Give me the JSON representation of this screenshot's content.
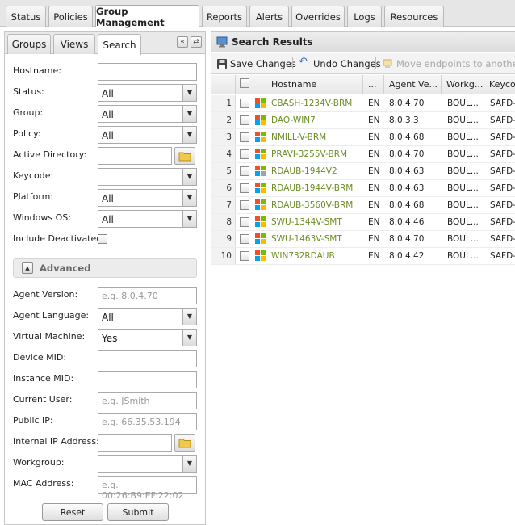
{
  "top_tabs": [
    {
      "label": "Status"
    },
    {
      "label": "Policies"
    },
    {
      "label": "Group Management",
      "active": true
    },
    {
      "label": "Reports"
    },
    {
      "label": "Alerts"
    },
    {
      "label": "Overrides"
    },
    {
      "label": "Logs"
    },
    {
      "label": "Resources"
    }
  ],
  "left_tabs": [
    {
      "label": "Groups"
    },
    {
      "label": "Views"
    },
    {
      "label": "Search",
      "active": true
    }
  ],
  "search_form": {
    "hostname_label": "Hostname:",
    "status_label": "Status:",
    "status_value": "All",
    "group_label": "Group:",
    "group_value": "All",
    "policy_label": "Policy:",
    "policy_value": "All",
    "active_directory_label": "Active Directory:",
    "keycode_label": "Keycode:",
    "keycode_value": "",
    "platform_label": "Platform:",
    "platform_value": "All",
    "windows_os_label": "Windows OS:",
    "windows_os_value": "All",
    "include_deactivated_label": "Include Deactivated:",
    "advanced_label": "Advanced",
    "agent_version_label": "Agent Version:",
    "agent_version_placeholder": "e.g. 8.0.4.70",
    "agent_language_label": "Agent Language:",
    "agent_language_value": "All",
    "virtual_machine_label": "Virtual Machine:",
    "virtual_machine_value": "Yes",
    "device_mid_label": "Device MID:",
    "instance_mid_label": "Instance MID:",
    "current_user_label": "Current User:",
    "current_user_placeholder": "e.g. JSmith",
    "public_ip_label": "Public IP:",
    "public_ip_placeholder": "e.g. 66.35.53.194",
    "internal_ip_label": "Internal IP Address:",
    "workgroup_label": "Workgroup:",
    "workgroup_value": "",
    "mac_address_label": "MAC Address:",
    "mac_address_placeholder": "e.g. 00:26:B9:EF:22:02",
    "reset_label": "Reset",
    "submit_label": "Submit"
  },
  "results": {
    "title": "Search Results",
    "toolbar": {
      "save_label": "Save Changes",
      "undo_label": "Undo Changes",
      "move_label": "Move endpoints to another gro"
    },
    "columns": {
      "hostname": "Hostname",
      "lang": "...",
      "agent_version": "Agent Ve...",
      "workgroup": "Workg...",
      "keycode": "Keyco"
    },
    "rows": [
      {
        "num": "1",
        "hostname": "CBASH-1234V-BRM",
        "lang": "EN",
        "version": "8.0.4.70",
        "workgroup": "BOUL...",
        "keycode": "SAFD-",
        "icon": "windows-icon"
      },
      {
        "num": "2",
        "hostname": "DAO-WIN7",
        "lang": "EN",
        "version": "8.0.3.3",
        "workgroup": "BOUL...",
        "keycode": "SAFD-",
        "icon": "windows-icon"
      },
      {
        "num": "3",
        "hostname": "NMILL-V-BRM",
        "lang": "EN",
        "version": "8.0.4.68",
        "workgroup": "BOUL...",
        "keycode": "SAFD-",
        "icon": "windows-icon"
      },
      {
        "num": "4",
        "hostname": "PRAVI-3255V-BRM",
        "lang": "EN",
        "version": "8.0.4.70",
        "workgroup": "BOUL...",
        "keycode": "SAFD-",
        "icon": "windows-icon"
      },
      {
        "num": "5",
        "hostname": "RDAUB-1944V2",
        "lang": "EN",
        "version": "8.0.4.63",
        "workgroup": "BOUL...",
        "keycode": "SAFD-",
        "icon": "windows-server-icon"
      },
      {
        "num": "6",
        "hostname": "RDAUB-1944V-BRM",
        "lang": "EN",
        "version": "8.0.4.63",
        "workgroup": "BOUL...",
        "keycode": "SAFD-",
        "icon": "windows-icon"
      },
      {
        "num": "7",
        "hostname": "RDAUB-3560V-BRM",
        "lang": "EN",
        "version": "8.0.4.68",
        "workgroup": "BOUL...",
        "keycode": "SAFD-",
        "icon": "windows-icon"
      },
      {
        "num": "8",
        "hostname": "SWU-1344V-SMT",
        "lang": "EN",
        "version": "8.0.4.46",
        "workgroup": "BOUL...",
        "keycode": "SAFD-",
        "icon": "windows-icon"
      },
      {
        "num": "9",
        "hostname": "SWU-1463V-SMT",
        "lang": "EN",
        "version": "8.0.4.70",
        "workgroup": "BOUL...",
        "keycode": "SAFD-",
        "icon": "windows-icon"
      },
      {
        "num": "10",
        "hostname": "WIN732RDAUB",
        "lang": "EN",
        "version": "8.0.4.42",
        "workgroup": "BOUL...",
        "keycode": "SAFD-",
        "icon": "windows-icon"
      }
    ]
  },
  "colors": {
    "hostname_link": "#6b8e23",
    "win_red": "#f25022",
    "win_green": "#7fba00",
    "win_blue": "#00a4ef",
    "win_yellow": "#ffb900"
  }
}
